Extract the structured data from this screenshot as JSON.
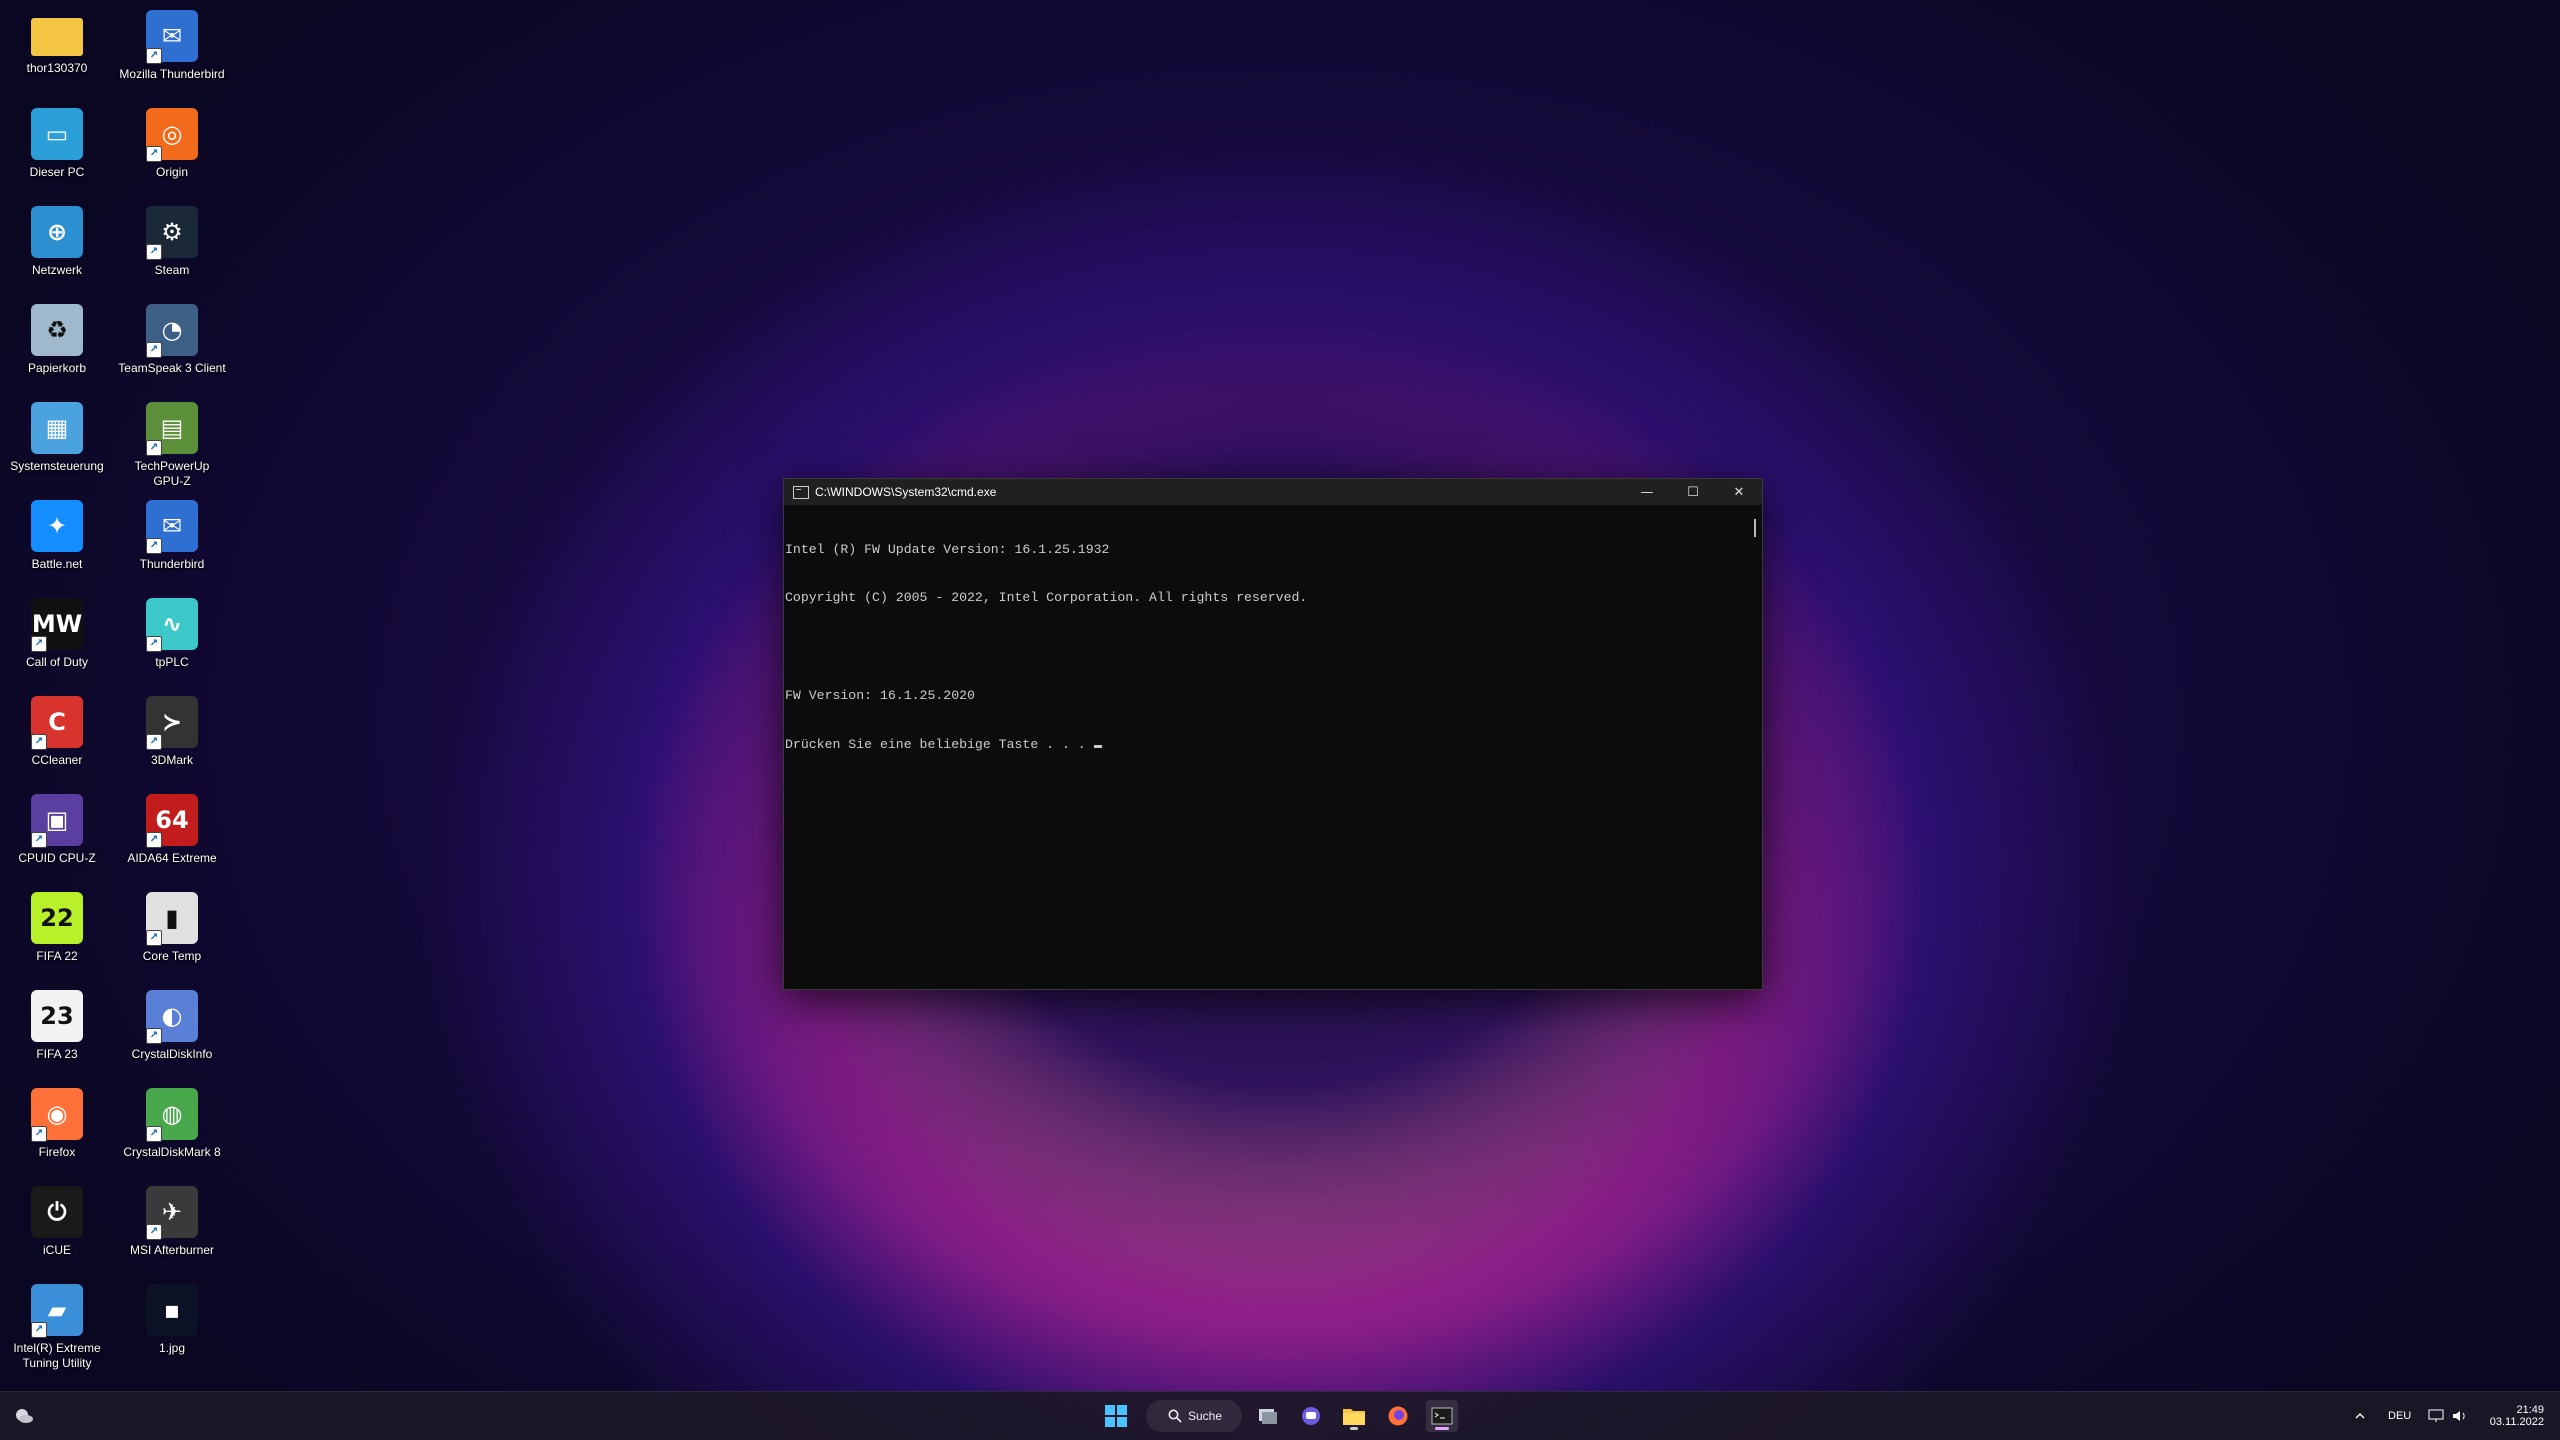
{
  "desktop": {
    "icons": [
      {
        "label": "thor130370",
        "color": "#f4c443",
        "glyph": "",
        "shortcut": false
      },
      {
        "label": "Mozilla Thunderbird",
        "color": "#2f6fd1",
        "glyph": "✉",
        "shortcut": true
      },
      {
        "label": "Dieser PC",
        "color": "#2a9fd8",
        "glyph": "▭",
        "shortcut": false
      },
      {
        "label": "Origin",
        "color": "#f26a1b",
        "glyph": "◎",
        "shortcut": true
      },
      {
        "label": "Netzwerk",
        "color": "#2b8fd0",
        "glyph": "⊕",
        "shortcut": false
      },
      {
        "label": "Steam",
        "color": "#1b2838",
        "glyph": "⚙",
        "shortcut": true
      },
      {
        "label": "Papierkorb",
        "color": "#9fb8cc",
        "glyph": "♻",
        "shortcut": false
      },
      {
        "label": "TeamSpeak 3 Client",
        "color": "#3d5f86",
        "glyph": "◔",
        "shortcut": true
      },
      {
        "label": "Systemsteuerung",
        "color": "#4aa3df",
        "glyph": "▦",
        "shortcut": false
      },
      {
        "label": "TechPowerUp GPU-Z",
        "color": "#5b8f3a",
        "glyph": "▤",
        "shortcut": true
      },
      {
        "label": "Battle.net",
        "color": "#148eff",
        "glyph": "✦",
        "shortcut": false
      },
      {
        "label": "Thunderbird",
        "color": "#2f6fd1",
        "glyph": "✉",
        "shortcut": true
      },
      {
        "label": "Call of Duty",
        "color": "#111111",
        "glyph": "MW",
        "shortcut": true
      },
      {
        "label": "tpPLC",
        "color": "#3dc9c9",
        "glyph": "∿",
        "shortcut": true
      },
      {
        "label": "CCleaner",
        "color": "#d9332e",
        "glyph": "C",
        "shortcut": true
      },
      {
        "label": "3DMark",
        "color": "#333333",
        "glyph": "≻",
        "shortcut": true
      },
      {
        "label": "CPUID CPU-Z",
        "color": "#5a3fa0",
        "glyph": "▣",
        "shortcut": true
      },
      {
        "label": "AIDA64 Extreme",
        "color": "#c21c1c",
        "glyph": "64",
        "shortcut": true
      },
      {
        "label": "FIFA 22",
        "color": "#b8f02a",
        "glyph": "22",
        "shortcut": false
      },
      {
        "label": "Core Temp",
        "color": "#e0e0e0",
        "glyph": "▮",
        "shortcut": true
      },
      {
        "label": "FIFA 23",
        "color": "#f2f2f2",
        "glyph": "23",
        "shortcut": false
      },
      {
        "label": "CrystalDiskInfo",
        "color": "#5a7fd6",
        "glyph": "◐",
        "shortcut": true
      },
      {
        "label": "Firefox",
        "color": "#ff7139",
        "glyph": "◉",
        "shortcut": true
      },
      {
        "label": "CrystalDiskMark 8",
        "color": "#49a84b",
        "glyph": "◍",
        "shortcut": true
      },
      {
        "label": "iCUE",
        "color": "#1a1a1a",
        "glyph": "⏻",
        "shortcut": false
      },
      {
        "label": "MSI Afterburner",
        "color": "#3a3a3a",
        "glyph": "✈",
        "shortcut": true
      },
      {
        "label": "Intel(R) Extreme Tuning Utility",
        "color": "#3b8fd8",
        "glyph": "▰",
        "shortcut": true
      },
      {
        "label": "1.jpg",
        "color": "#0b1225",
        "glyph": "▪",
        "shortcut": false
      }
    ]
  },
  "cmd": {
    "title": "C:\\WINDOWS\\System32\\cmd.exe",
    "lines": [
      "Intel (R) FW Update Version: 16.1.25.1932",
      "Copyright (C) 2005 - 2022, Intel Corporation. All rights reserved.",
      "",
      "FW Version: 16.1.25.2020",
      "Drücken Sie eine beliebige Taste . . . "
    ],
    "minimize_glyph": "—",
    "maximize_glyph": "☐",
    "close_glyph": "✕"
  },
  "taskbar": {
    "search_label": "Suche",
    "language": "DEU",
    "time": "21:49",
    "date": "03.11.2022"
  }
}
